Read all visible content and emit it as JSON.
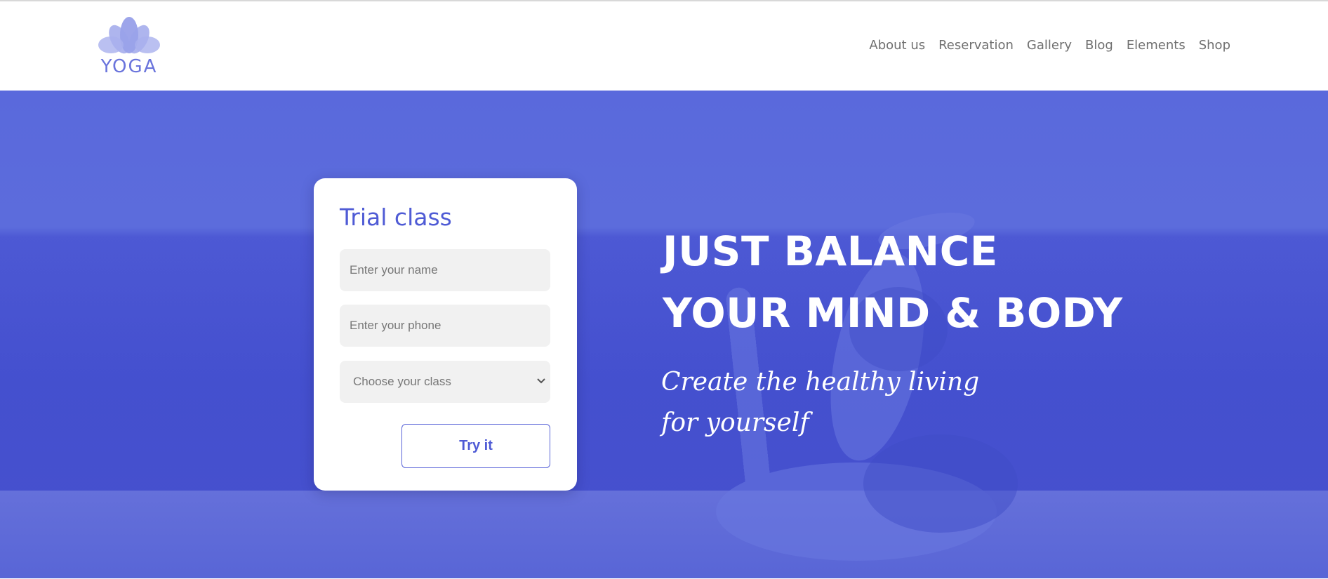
{
  "brand": {
    "name": "YOGA",
    "logo_icon": "lotus-icon",
    "accent": "#5a69dc"
  },
  "nav": {
    "items": [
      {
        "label": "About us"
      },
      {
        "label": "Reservation"
      },
      {
        "label": "Gallery"
      },
      {
        "label": "Blog"
      },
      {
        "label": "Elements"
      },
      {
        "label": "Shop"
      }
    ]
  },
  "form": {
    "title": "Trial class",
    "name_placeholder": "Enter your name",
    "phone_placeholder": "Enter your phone",
    "class_select": "Choose your class",
    "submit_label": "Try it"
  },
  "hero": {
    "headline_line1": "JUST BALANCE",
    "headline_line2": "YOUR MIND & BODY",
    "tagline_line1": "Create the healthy living",
    "tagline_line2": "for yourself"
  }
}
